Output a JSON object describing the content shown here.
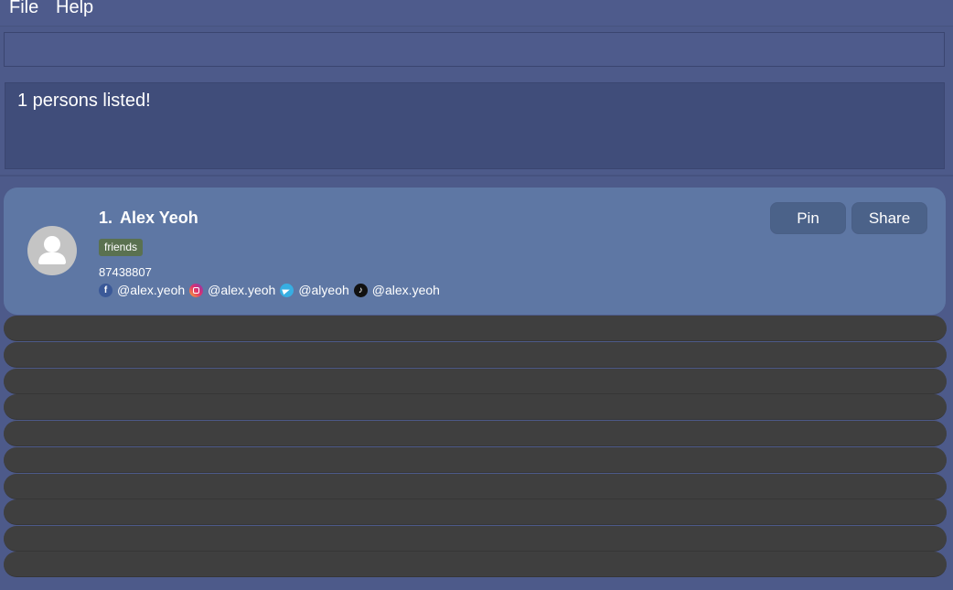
{
  "menubar": {
    "items": [
      {
        "label": "File"
      },
      {
        "label": "Help"
      }
    ]
  },
  "command": {
    "value": ""
  },
  "result": {
    "message": "1 persons listed!"
  },
  "persons": [
    {
      "index": "1.",
      "name": "Alex Yeoh",
      "tags": [
        "friends"
      ],
      "phone": "87438807",
      "socials": [
        {
          "icon": "facebook-icon",
          "handle": "@alex.yeoh"
        },
        {
          "icon": "instagram-icon",
          "handle": "@alex.yeoh"
        },
        {
          "icon": "telegram-icon",
          "handle": "@alyeoh"
        },
        {
          "icon": "tiktok-icon",
          "handle": "@alex.yeoh"
        }
      ],
      "buttons": {
        "pin": "Pin",
        "share": "Share"
      }
    }
  ],
  "colors": {
    "background": "#4d5a8a",
    "card": "#5e77a4",
    "tag": "#5a7150",
    "empty_row": "#3f3f3f",
    "button": "#4b6289"
  }
}
